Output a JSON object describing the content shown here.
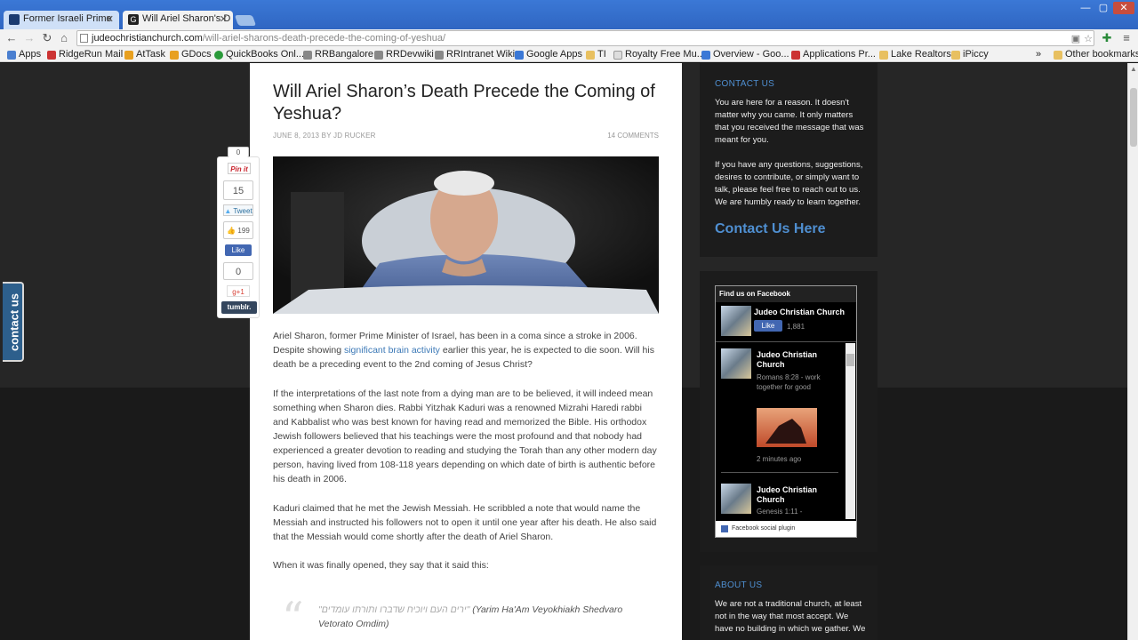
{
  "browser": {
    "tabs": [
      {
        "title": "Former Israeli Prime",
        "active": false
      },
      {
        "title": "Will Ariel Sharon's D",
        "active": true
      }
    ],
    "url_host": "judeochristianchurch.com",
    "url_path": "/will-ariel-sharons-death-precede-the-coming-of-yeshua/",
    "bookmarks": [
      "Apps",
      "RidgeRun Mail",
      "AtTask",
      "GDocs",
      "QuickBooks Onl...",
      "RRBangalore",
      "RRDevwiki",
      "RRIntranet Wiki",
      "Google Apps",
      "TI",
      "Royalty Free Mu...",
      "Overview - Goo...",
      "Applications Pr...",
      "Lake Realtors",
      "iPiccy"
    ],
    "overflow_chevron": "»",
    "other_bookmarks": "Other bookmarks"
  },
  "article": {
    "title": "Will Ariel Sharon’s Death Precede the Coming of Yeshua?",
    "date": "JUNE 8, 2013",
    "by": "BY",
    "author": "JD RUCKER",
    "comments": "14 COMMENTS",
    "p1_before": "Ariel Sharon, former Prime Minister of Israel, has been in a coma since a stroke in 2006. Despite showing ",
    "p1_link": "significant brain activity",
    "p1_after": " earlier this year, he is expected to die soon. Will his death be a preceding event to the 2nd coming of Jesus Christ?",
    "p2": "If the interpretations of the last note from a dying man are to be believed, it will indeed mean something when Sharon dies. Rabbi Yitzhak Kaduri was a renowned Mizrahi Haredi rabbi and Kabbalist who was best known for having read and memorized the Bible. His orthodox Jewish followers believed that his teachings were the most profound and that nobody had experienced a greater devotion to reading and studying the Torah than any other modern day person, having lived from 108-118 years depending on which date of birth is authentic before his death in 2006.",
    "p3": "Kaduri claimed that he met the Jewish Messiah. He scribbled a note that would name the Messiah and instructed his followers not to open it until one year after his death. He also said that the Messiah would come shortly after the death of Ariel Sharon.",
    "p4": "When it was finally opened, they say that it said this:",
    "quote_mark": "“",
    "quote_hebrew": "\"ירים העם ויוכיח שדברו ותורתו עומדים\" ",
    "quote_latin": "(Yarim Ha'Am Veyokhiakh Shedvaro Vetorato Omdim)"
  },
  "share": {
    "pin_count": "0",
    "pin_label": "Pin it",
    "tweet_count": "15",
    "tweet_label": "Tweet",
    "like_count": "199",
    "fb_like_label": "Like",
    "gplus_count": "0",
    "gplus_label": "g+1",
    "tumblr_label": "tumblr."
  },
  "sidebar": {
    "contact_heading": "CONTACT US",
    "contact_p1": "You are here for a reason. It doesn't matter why you came. It only matters that you received the message that was meant for you.",
    "contact_p2": "If you have any questions, suggestions, desires to contribute, or simply want to talk, please feel free to reach out to us. We are humbly ready to learn together.",
    "contact_link": "Contact Us Here",
    "fb_header": "Find us on Facebook",
    "fb_page": "Judeo Christian Church",
    "fb_like": "Like",
    "fb_likes": "1,881",
    "post1_name": "Judeo Christian Church",
    "post1_text": "Romans 8:28 - work together for good",
    "post1_time": "2 minutes ago",
    "post2_name": "Judeo Christian Church",
    "post2_text": "Genesis 1:11 -",
    "fb_plugin": "Facebook social plugin",
    "about_heading": "ABOUT US",
    "about_p": "We are not a traditional church, at least not in the way that most accept. We have no building in which we gather. We"
  },
  "contact_tab": "contact us",
  "colors": {
    "accent": "#4f8fd1",
    "link": "#3b78b6",
    "chrome_blue": "#3b78d6"
  }
}
